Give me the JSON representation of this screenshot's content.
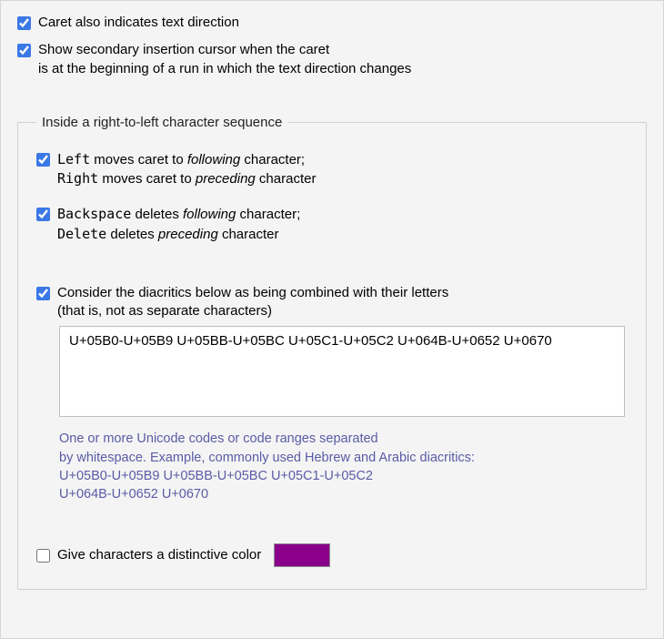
{
  "checkbox_caret_direction": "Caret also indicates text direction",
  "checkbox_secondary_line1": "Show secondary insertion cursor when the caret",
  "checkbox_secondary_line2": "is at the beginning of a run in which the text direction changes",
  "group_legend": "Inside a right-to-left character sequence",
  "opt1_l1p1": "Left",
  "opt1_l1p2": " moves caret to ",
  "opt1_l1p3": "following",
  "opt1_l1p4": " character;",
  "opt1_l2p1": "Right",
  "opt1_l2p2": " moves caret to ",
  "opt1_l2p3": "preceding",
  "opt1_l2p4": " character",
  "opt2_l1p1": "Backspace",
  "opt2_l1p2": " deletes ",
  "opt2_l1p3": "following",
  "opt2_l1p4": " character;",
  "opt2_l2p1": "Delete",
  "opt2_l2p2": " deletes ",
  "opt2_l2p3": "preceding",
  "opt2_l2p4": " character",
  "opt3_l1": "Consider the diacritics below as being combined with their letters",
  "opt3_l2": "(that is, not as separate characters)",
  "diacritics_text": "U+05B0-U+05B9 U+05BB-U+05BC U+05C1-U+05C2 U+064B-U+0652 U+0670",
  "hint_l1": "One or more Unicode codes or code ranges separated",
  "hint_l2": "by whitespace. Example, commonly used Hebrew and Arabic diacritics:",
  "hint_l3": "U+05B0-U+05B9 U+05BB-U+05BC U+05C1-U+05C2",
  "hint_l4": "U+064B-U+0652 U+0670",
  "checkbox_color": "Give characters a distinctive color",
  "distinctive_color": "#8b008b"
}
